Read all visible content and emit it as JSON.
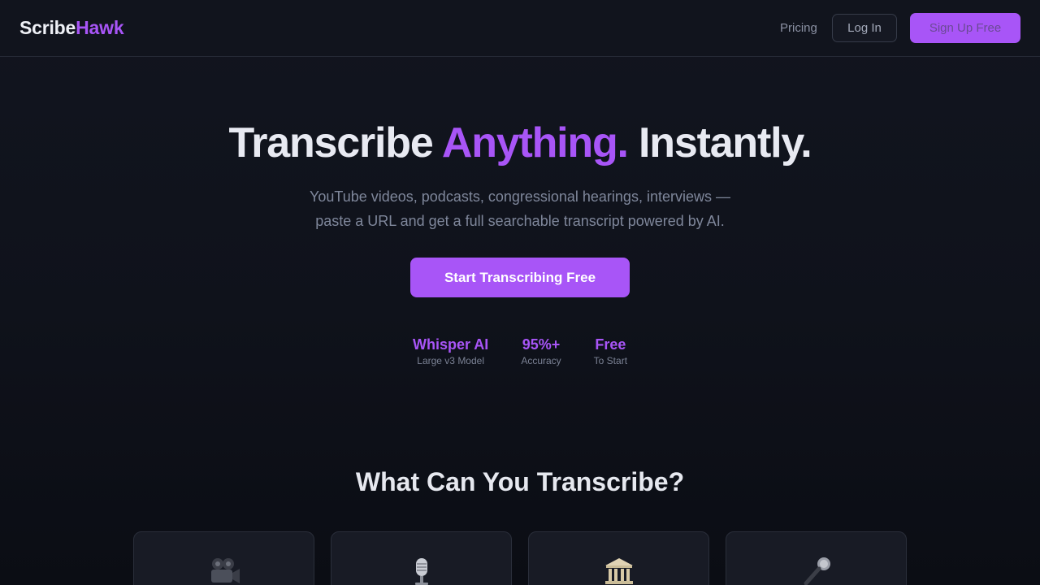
{
  "header": {
    "logo_part1": "Scribe",
    "logo_part2": "Hawk",
    "nav_pricing": "Pricing",
    "login_label": "Log In",
    "signup_label": "Sign Up Free"
  },
  "hero": {
    "title_before": "Transcribe ",
    "title_accent": "Anything.",
    "title_after": " Instantly.",
    "subtitle_line1": "YouTube videos, podcasts, congressional hearings, interviews —",
    "subtitle_line2": "paste a URL and get a full searchable transcript powered by AI.",
    "cta_label": "Start Transcribing Free"
  },
  "stats": [
    {
      "value": "Whisper AI",
      "label": "Large v3 Model"
    },
    {
      "value": "95%+",
      "label": "Accuracy"
    },
    {
      "value": "Free",
      "label": "To Start"
    }
  ],
  "section": {
    "title": "What Can You Transcribe?"
  },
  "cards": [
    {
      "icon": "movie-camera-icon"
    },
    {
      "icon": "studio-microphone-icon"
    },
    {
      "icon": "classical-building-icon"
    },
    {
      "icon": "microphone-icon"
    }
  ],
  "colors": {
    "accent": "#a855f7",
    "background": "#0d1019",
    "card": "#181b25"
  }
}
